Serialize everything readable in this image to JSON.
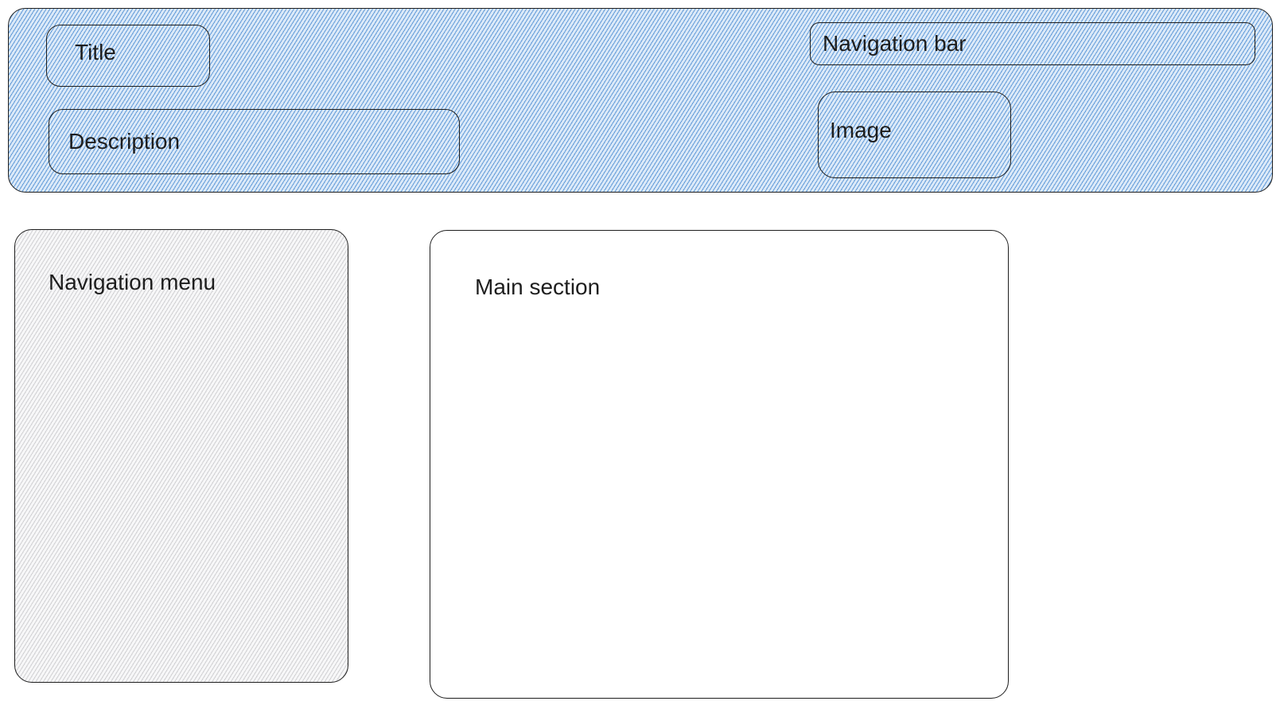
{
  "header": {
    "fill_color": "#a5c8ec",
    "title_label": "Title",
    "description_label": "Description",
    "navigation_bar_label": "Navigation bar",
    "image_label": "Image"
  },
  "navigation_menu": {
    "label": "Navigation menu"
  },
  "main_section": {
    "label": "Main section"
  },
  "colors": {
    "stroke": "#1e1e1e",
    "menu_fill": "#e9e9ec",
    "main_fill": "#ffffff"
  }
}
